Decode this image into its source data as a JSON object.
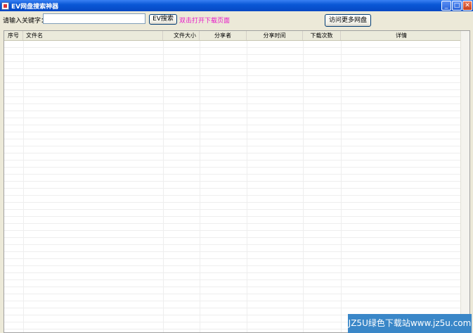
{
  "window": {
    "title": "EV网盘搜索神器",
    "controls": {
      "minimize": "_",
      "maximize": "□",
      "close": "✕"
    }
  },
  "toolbar": {
    "keyword_label": "请输入关键字：",
    "search_value": "",
    "search_placeholder": "",
    "search_button": "EV搜索",
    "hint": "双击打开下载页面",
    "more_button": "访问更多网盘"
  },
  "table": {
    "columns": [
      "序号",
      "文件名",
      "文件大小",
      "分享者",
      "分享时间",
      "下载次数",
      "详情"
    ],
    "rows": []
  },
  "watermark": "JZ5U绿色下载站www.jz5u.com",
  "colors": {
    "hint": "#e616c8",
    "titlebar": "#0a58d6"
  }
}
